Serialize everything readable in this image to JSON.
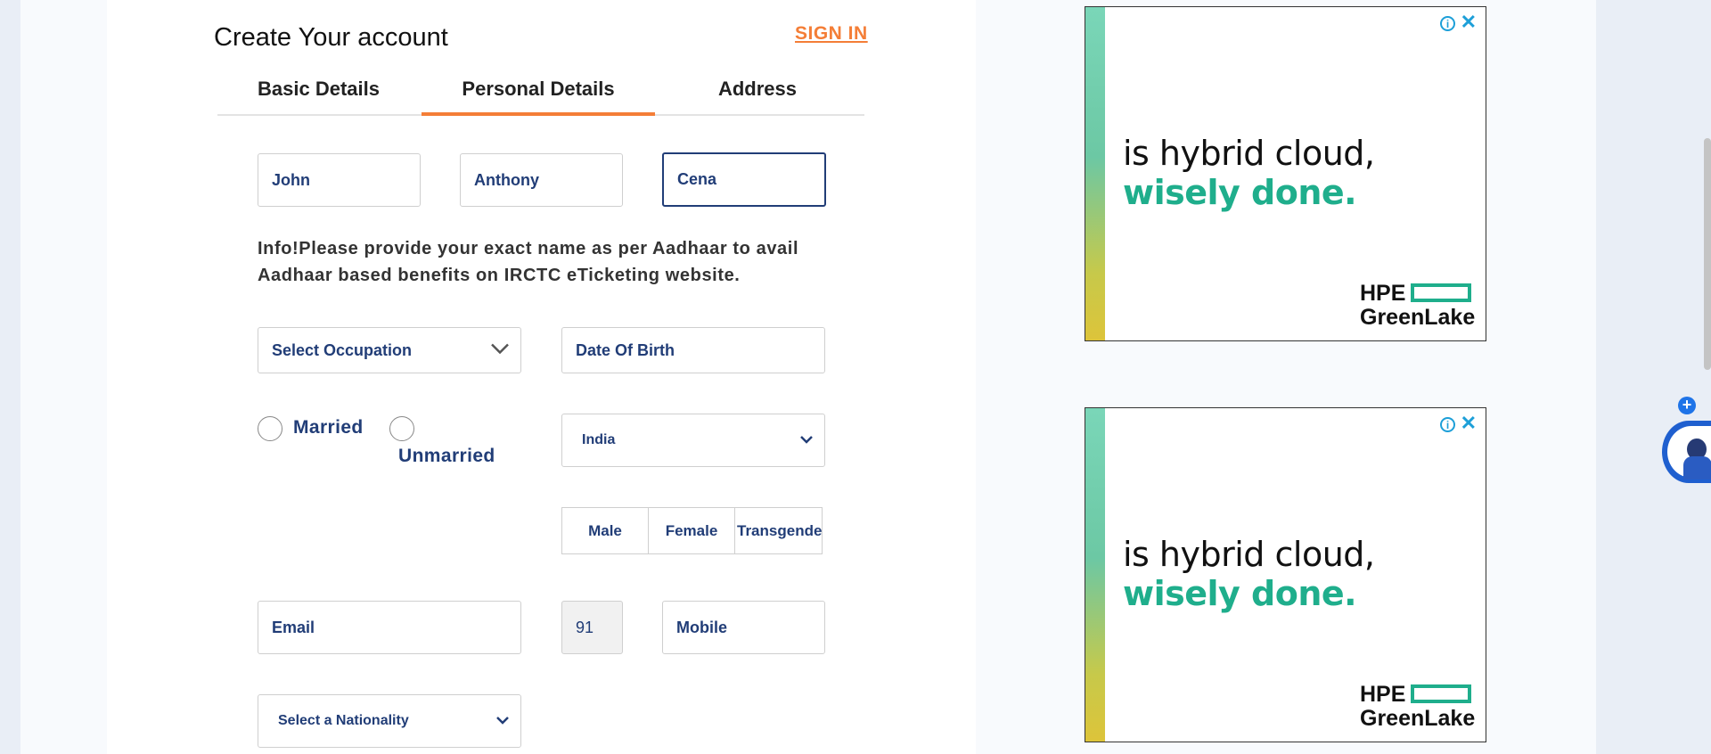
{
  "header": {
    "title": "Create Your account",
    "signin_label": "SIGN IN"
  },
  "tabs": [
    {
      "label": "Basic Details",
      "active": false
    },
    {
      "label": "Personal Details",
      "active": true
    },
    {
      "label": "Address",
      "active": false
    }
  ],
  "name": {
    "first": "John",
    "middle": "Anthony",
    "last": "Cena"
  },
  "info_text": "Info!Please provide your exact name as per Aadhaar to avail Aadhaar based benefits on IRCTC eTicketing website.",
  "occupation": {
    "placeholder": "Select Occupation"
  },
  "dob": {
    "placeholder": "Date Of Birth"
  },
  "marital": {
    "married_label": "Married",
    "unmarried_label": "Unmarried"
  },
  "country": {
    "selected": "India"
  },
  "gender": {
    "male": "Male",
    "female": "Female",
    "transgender": "Transgende"
  },
  "email": {
    "placeholder": "Email"
  },
  "country_code": {
    "value": "91"
  },
  "mobile": {
    "placeholder": "Mobile"
  },
  "nationality": {
    "selected": "Select a Nationality"
  },
  "ads": [
    {
      "line1": "is hybrid cloud,",
      "line2": "wisely done.",
      "logo_top": "HPE",
      "logo_bottom": "GreenLake"
    },
    {
      "line1": "is hybrid cloud,",
      "line2": "wisely done.",
      "logo_top": "HPE",
      "logo_bottom": "GreenLake"
    }
  ],
  "colors": {
    "accent": "#f47e37",
    "navy": "#213d77",
    "ad_green": "#1fae8c",
    "ad_info_blue": "#1d9fd8"
  }
}
